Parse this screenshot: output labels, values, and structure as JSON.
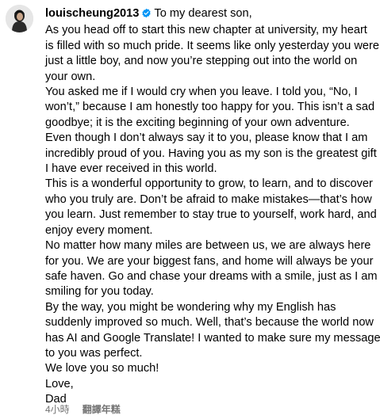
{
  "post": {
    "username": "louischeung2013",
    "verified_icon": "verified-badge-icon",
    "first_line": "To my dearest son,",
    "lines": [
      "As you head off to start this new chapter at university, my heart",
      "is filled with so much pride. It seems like only yesterday you were",
      "just a little boy, and now you’re stepping out into the world on",
      "your own.",
      "You asked me if I would cry when you leave. I told you, “No, I",
      "won’t,” because I am honestly too happy for you. This isn’t a sad",
      "goodbye; it is the exciting beginning of your own adventure.",
      "Even though I don’t always say it to you, please know that I am",
      "incredibly proud of you. Having you as my son is the greatest gift",
      "I have ever received in this world.",
      "This is a wonderful opportunity to grow, to learn, and to discover",
      "who you truly are. Don’t be afraid to make mistakes—that’s how",
      "you learn. Just remember to stay true to yourself, work hard, and",
      "enjoy every moment.",
      "No matter how many miles are between us, we are always here",
      "for you. We are your biggest fans, and home will always be your",
      "safe haven. Go and chase your dreams with a smile, just as I am",
      "smiling for you today.",
      "By the way, you might be wondering why my English has",
      "suddenly improved so much. Well, that’s because the world now",
      "has AI and Google Translate! I wanted to make sure my message",
      "to you was perfect.",
      "We love you so much!",
      "Love,",
      "Dad"
    ],
    "timestamp": "4小時",
    "translate_label": "翻譯年糕"
  },
  "colors": {
    "verified": "#0095f6",
    "meta_text": "#737373"
  }
}
